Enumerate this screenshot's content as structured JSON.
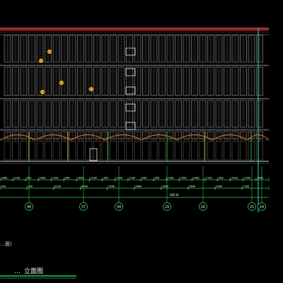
{
  "drawing": {
    "title": "立面图",
    "title_prefix": "…",
    "partial_note": "…面)",
    "colors": {
      "background": "#000000",
      "window_grid": "#e6e6e6",
      "roof": "#d23232",
      "facade_frame": "#c8c8c8",
      "arch_orange": "#e07a24",
      "gridline_cyan": "#3fd7d2",
      "dim_green": "#2ad24a",
      "dim_yellow": "#e6d23a",
      "caption_green": "#2ec24a"
    }
  },
  "dimensions": {
    "row1": [
      "1800",
      "2100",
      "900",
      "5400",
      "2100",
      "900",
      "4800",
      "2100",
      "300",
      "2400",
      "2100",
      "900",
      "900",
      "2100",
      "2400",
      "2400",
      "2100",
      "300",
      "2400",
      "2500",
      "1800"
    ],
    "row2": [
      "900",
      "400",
      "8100",
      "8400",
      "5600",
      "4800",
      "5800",
      "8000",
      "5600",
      "1900"
    ],
    "overall": "60534"
  },
  "axes": [
    {
      "label": "40"
    },
    {
      "label": "37"
    },
    {
      "label": "34"
    },
    {
      "label": "29"
    },
    {
      "label": "26"
    },
    {
      "label": "25"
    },
    {
      "label": "24"
    }
  ]
}
